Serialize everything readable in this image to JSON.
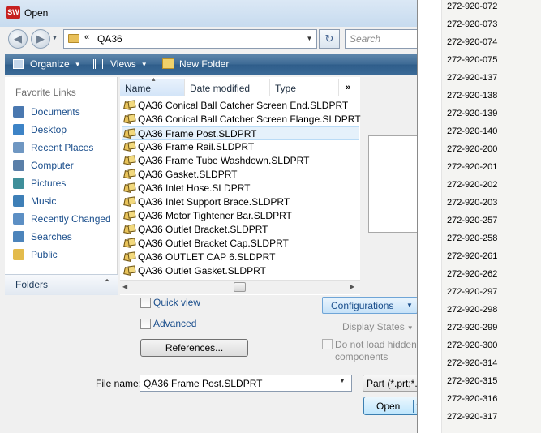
{
  "window": {
    "title": "Open",
    "app_icon": "SW"
  },
  "address": {
    "chevrons": "«",
    "path": "QA36",
    "search_placeholder": "Search"
  },
  "toolbar": {
    "organize": "Organize",
    "views": "Views",
    "new_folder": "New Folder"
  },
  "favorites": {
    "heading": "Favorite Links",
    "items": [
      {
        "label": "Documents",
        "icon": "documents-icon",
        "color": "#4a78b0"
      },
      {
        "label": "Desktop",
        "icon": "desktop-icon",
        "color": "#3d83c6"
      },
      {
        "label": "Recent Places",
        "icon": "recent-places-icon",
        "color": "#6f97c2"
      },
      {
        "label": "Computer",
        "icon": "computer-icon",
        "color": "#5a7fa8"
      },
      {
        "label": "Pictures",
        "icon": "pictures-icon",
        "color": "#3f8f9a"
      },
      {
        "label": "Music",
        "icon": "music-icon",
        "color": "#3e7fb7"
      },
      {
        "label": "Recently Changed",
        "icon": "recently-changed-icon",
        "color": "#5c8fc4"
      },
      {
        "label": "Searches",
        "icon": "searches-icon",
        "color": "#4c84bb"
      },
      {
        "label": "Public",
        "icon": "public-folder-icon",
        "color": "#e3bb4c"
      }
    ],
    "folders_label": "Folders"
  },
  "columns": {
    "name": "Name",
    "date": "Date modified",
    "type": "Type",
    "more": "»"
  },
  "files": [
    {
      "name": "QA36 Conical Ball Catcher Screen End.SLDPRT"
    },
    {
      "name": "QA36 Conical Ball Catcher Screen Flange.SLDPRT"
    },
    {
      "name": "QA36 Frame Post.SLDPRT",
      "selected": true
    },
    {
      "name": "QA36 Frame Rail.SLDPRT"
    },
    {
      "name": "QA36 Frame Tube Washdown.SLDPRT"
    },
    {
      "name": "QA36 Gasket.SLDPRT"
    },
    {
      "name": "QA36 Inlet Hose.SLDPRT"
    },
    {
      "name": "QA36 Inlet Support Brace.SLDPRT"
    },
    {
      "name": "QA36 Motor Tightener Bar.SLDPRT"
    },
    {
      "name": "QA36 Outlet Bracket.SLDPRT"
    },
    {
      "name": "QA36 Outlet Bracket Cap.SLDPRT"
    },
    {
      "name": "QA36 OUTLET CAP 6.SLDPRT"
    },
    {
      "name": "QA36 Outlet Gasket.SLDPRT"
    }
  ],
  "options": {
    "quick_view": "Quick view",
    "advanced": "Advanced",
    "references": "References...",
    "configurations": "Configurations",
    "display_states": "Display States",
    "no_load_hidden": "Do not load hidden components"
  },
  "file_name": {
    "label": "File name:",
    "value": "QA36 Frame Post.SLDPRT",
    "type_filter": "Part (*.prt;*.sldprt)",
    "open": "Open"
  },
  "part_numbers": [
    "272-920-072",
    "272-920-073",
    "272-920-074",
    "272-920-075",
    "272-920-137",
    "272-920-138",
    "272-920-139",
    "272-920-140",
    "272-920-200",
    "272-920-201",
    "272-920-202",
    "272-920-203",
    "272-920-257",
    "272-920-258",
    "272-920-261",
    "272-920-262",
    "272-920-297",
    "272-920-298",
    "272-920-299",
    "272-920-300",
    "272-920-314",
    "272-920-315",
    "272-920-316",
    "272-920-317"
  ]
}
